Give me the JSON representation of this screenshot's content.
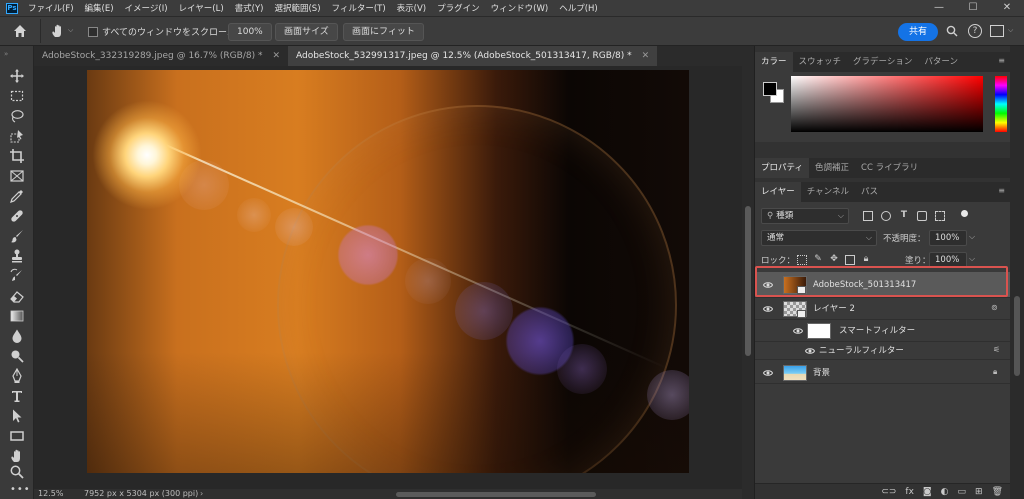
{
  "app": {
    "logo": "Ps",
    "menu": [
      "ファイル(F)",
      "編集(E)",
      "イメージ(I)",
      "レイヤー(L)",
      "書式(Y)",
      "選択範囲(S)",
      "フィルター(T)",
      "表示(V)",
      "プラグイン",
      "ウィンドウ(W)",
      "ヘルプ(H)"
    ],
    "window_controls": [
      "—",
      "☐",
      "✕"
    ]
  },
  "options_bar": {
    "scroll_all_label": "すべてのウィンドウをスクロール",
    "zoom_100": "100%",
    "fit_screen": "画面サイズ",
    "fill_screen": "画面にフィット",
    "share": "共有"
  },
  "tabs": [
    {
      "label": "AdobeStock_332319289.jpeg @ 16.7% (RGB/8) *",
      "active": false
    },
    {
      "label": "AdobeStock_532991317.jpeg @ 12.5% (AdobeStock_501313417, RGB/8) *",
      "active": true
    }
  ],
  "status": {
    "zoom": "12.5%",
    "dimensions": "7952 px x 5304 px (300 ppi)"
  },
  "color_panel": {
    "tabs": [
      "カラー",
      "スウォッチ",
      "グラデーション",
      "パターン"
    ],
    "foreground": "#000000",
    "background": "#ffffff"
  },
  "props_panel": {
    "tabs": [
      "プロパティ",
      "色調補正",
      "CC ライブラリ"
    ]
  },
  "layers_panel": {
    "tabs": [
      "レイヤー",
      "チャンネル",
      "パス"
    ],
    "filter_kind": "種類",
    "blend_mode": "通常",
    "opacity_label": "不透明度：",
    "opacity_value": "100%",
    "lock_label": "ロック：",
    "fill_label": "塗り：",
    "fill_value": "100%",
    "layers": [
      {
        "name": "AdobeStock_501313417",
        "selected": true
      },
      {
        "name": "レイヤー 2",
        "selected": false
      },
      {
        "name": "スマートフィルター",
        "selected": false
      },
      {
        "name": "ニューラルフィルター",
        "selected": false
      },
      {
        "name": "背景",
        "selected": false
      }
    ],
    "footer_fx": "fx"
  },
  "colors": {
    "accent": "#1473e6",
    "selection_outline": "#d9534f"
  }
}
